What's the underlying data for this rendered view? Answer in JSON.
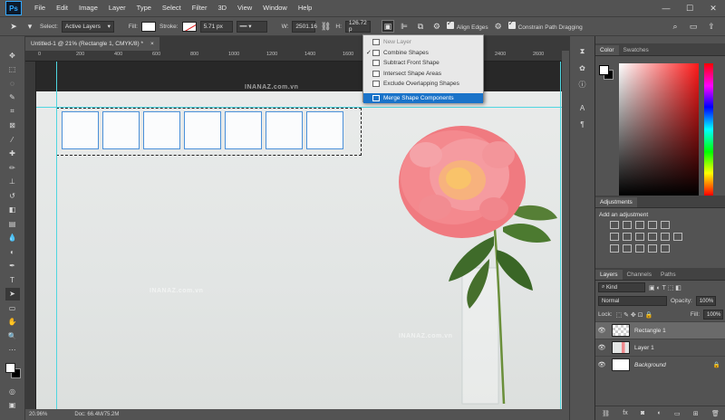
{
  "menubar": {
    "logo": "Ps",
    "items": [
      "File",
      "Edit",
      "Image",
      "Layer",
      "Type",
      "Select",
      "Filter",
      "3D",
      "View",
      "Window",
      "Help"
    ],
    "controls": [
      "—",
      "☐",
      "✕"
    ]
  },
  "options": {
    "select_label": "Select:",
    "select_value": "Active Layers",
    "fill_label": "Fill:",
    "stroke_label": "Stroke:",
    "stroke_width": "5.71 px",
    "w_label": "W:",
    "w_value": "2501.16",
    "h_label": "H:",
    "h_value": "126.72 p",
    "align_edges": "Align Edges",
    "constrain": "Constrain Path Dragging"
  },
  "path_ops_menu": {
    "items": [
      {
        "label": "New Layer",
        "state": "disabled"
      },
      {
        "label": "Combine Shapes",
        "state": "checked"
      },
      {
        "label": "Subtract Front Shape",
        "state": "normal"
      },
      {
        "label": "Intersect Shape Areas",
        "state": "normal"
      },
      {
        "label": "Exclude Overlapping Shapes",
        "state": "normal"
      }
    ],
    "merge_label": "Merge Shape Components"
  },
  "document": {
    "tab_title": "Untitled-1 @ 21% (Rectangle 1, CMYK/8) *",
    "close": "×",
    "ruler_ticks": [
      "0",
      "200",
      "400",
      "600",
      "800",
      "1000",
      "1200",
      "1400",
      "1600",
      "1800",
      "2000",
      "2200",
      "2400",
      "2600"
    ],
    "rect_count": 7
  },
  "status": {
    "zoom": "20.96%",
    "doc": "Doc: 66.4M/75.2M"
  },
  "color_panel": {
    "tabs": [
      "Color",
      "Swatches"
    ]
  },
  "adjustments": {
    "tab": "Adjustments",
    "subtitle": "Add an adjustment"
  },
  "layers_panel": {
    "tabs": [
      "Layers",
      "Channels",
      "Paths"
    ],
    "kind": "Kind",
    "blend_mode": "Normal",
    "opacity_label": "Opacity:",
    "opacity": "100%",
    "lock_label": "Lock:",
    "fill_label": "Fill:",
    "fill": "100%",
    "layers": [
      {
        "name": "Rectangle 1",
        "thumb": "checker",
        "selected": true
      },
      {
        "name": "Layer 1",
        "thumb": "photo",
        "selected": false
      },
      {
        "name": "Background",
        "thumb": "white",
        "selected": false
      }
    ],
    "footer_icons": [
      "link",
      "fx",
      "mask",
      "adjust",
      "group",
      "new",
      "trash"
    ]
  },
  "watermark": "INANAZ.com.vn",
  "colors": {
    "accent": "#1a73c9",
    "guide": "#4fd6e0",
    "ui_bg": "#535353"
  }
}
